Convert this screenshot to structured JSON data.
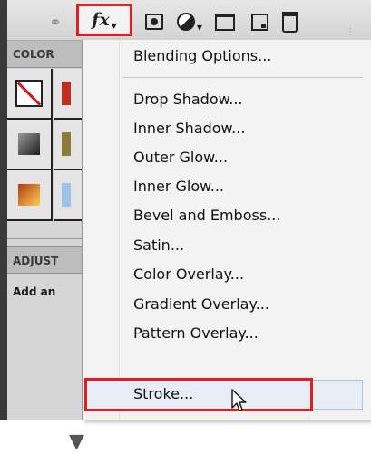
{
  "toolbar": {
    "icons": [
      "link-icon",
      "fx-icon",
      "add-mask-icon",
      "adjustment-layer-icon",
      "folder-icon",
      "new-layer-icon",
      "trash-icon"
    ],
    "fx_label": "fx"
  },
  "left_panel": {
    "color_tab": "COLOR",
    "adjust_tab": "ADJUST",
    "add_text": "Add an"
  },
  "menu": {
    "items": [
      "Blending Options...",
      "Drop Shadow...",
      "Inner Shadow...",
      "Outer Glow...",
      "Inner Glow...",
      "Bevel and Emboss...",
      "Satin...",
      "Color Overlay...",
      "Gradient Overlay...",
      "Pattern Overlay...",
      "Stroke..."
    ],
    "highlighted_item": "Stroke...",
    "highlight_color": "#e02020"
  }
}
